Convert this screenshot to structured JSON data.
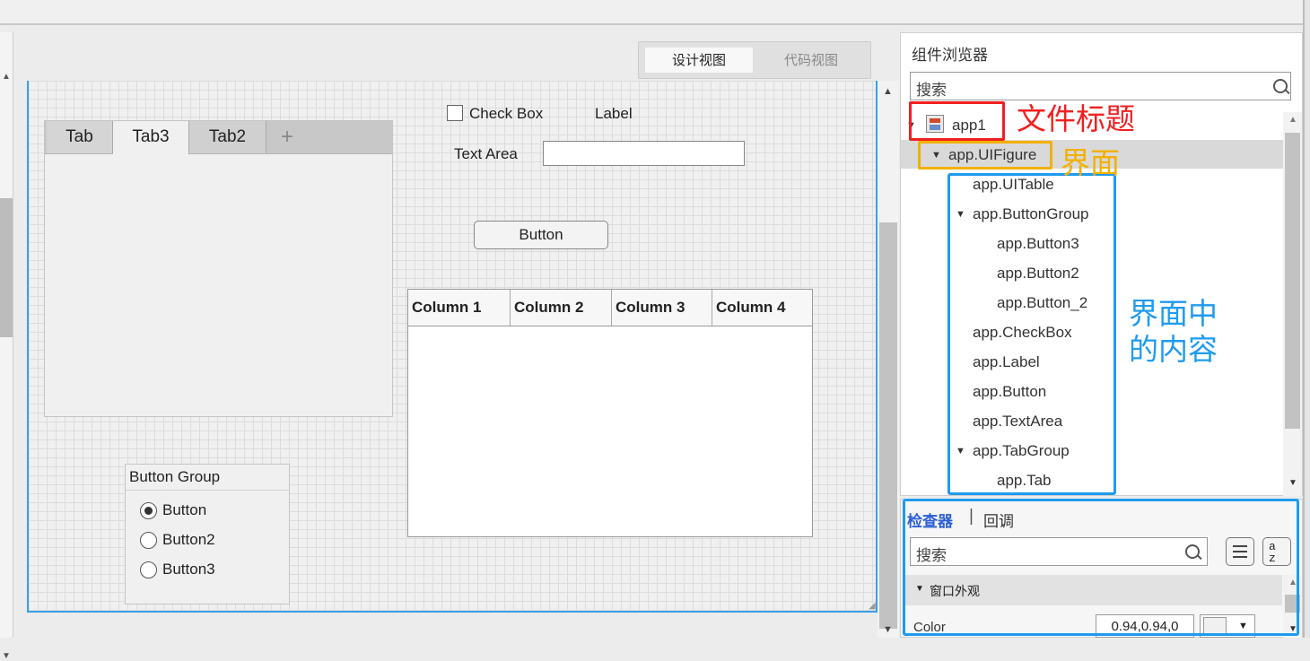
{
  "view_toggle": {
    "design": "设计视图",
    "code": "代码视图"
  },
  "canvas": {
    "tabs": [
      "Tab",
      "Tab3",
      "Tab2",
      "+"
    ],
    "checkbox_label": "Check Box",
    "label_text": "Label",
    "textarea_label": "Text Area",
    "button_label": "Button",
    "table_columns": [
      "Column 1",
      "Column 2",
      "Column 3",
      "Column 4"
    ],
    "button_group": {
      "title": "Button Group",
      "options": [
        "Button",
        "Button2",
        "Button3"
      ],
      "selected": "Button"
    }
  },
  "browser": {
    "title": "组件浏览器",
    "search_placeholder": "搜索",
    "tree": [
      {
        "label": "app1",
        "level": 0,
        "expanded": true
      },
      {
        "label": "app.UIFigure",
        "level": 1,
        "expanded": true,
        "selected": true
      },
      {
        "label": "app.UITable",
        "level": 2
      },
      {
        "label": "app.ButtonGroup",
        "level": 2,
        "expanded": true
      },
      {
        "label": "app.Button3",
        "level": 3
      },
      {
        "label": "app.Button2",
        "level": 3
      },
      {
        "label": "app.Button_2",
        "level": 3
      },
      {
        "label": "app.CheckBox",
        "level": 2
      },
      {
        "label": "app.Label",
        "level": 2
      },
      {
        "label": "app.Button",
        "level": 2
      },
      {
        "label": "app.TextArea",
        "level": 2
      },
      {
        "label": "app.TabGroup",
        "level": 2,
        "expanded": true
      },
      {
        "label": "app.Tab",
        "level": 3
      }
    ]
  },
  "inspector": {
    "tab_inspector": "检查器",
    "tab_separator": "|",
    "tab_callback": "回调",
    "search_placeholder": "搜索",
    "sort_glyph_top": "a",
    "sort_glyph_bottom": "z",
    "section": "窗口外观",
    "property_name": "Color",
    "property_value": "0.94,0.94,0",
    "color_swatch": "#f0f0f0"
  },
  "annotations": {
    "file_title": "文件标题",
    "interface": "界面",
    "interface_content": "界面中的内容",
    "colors": {
      "red": "#f02020",
      "orange": "#f2b000",
      "blue": "#1e9bef"
    }
  }
}
